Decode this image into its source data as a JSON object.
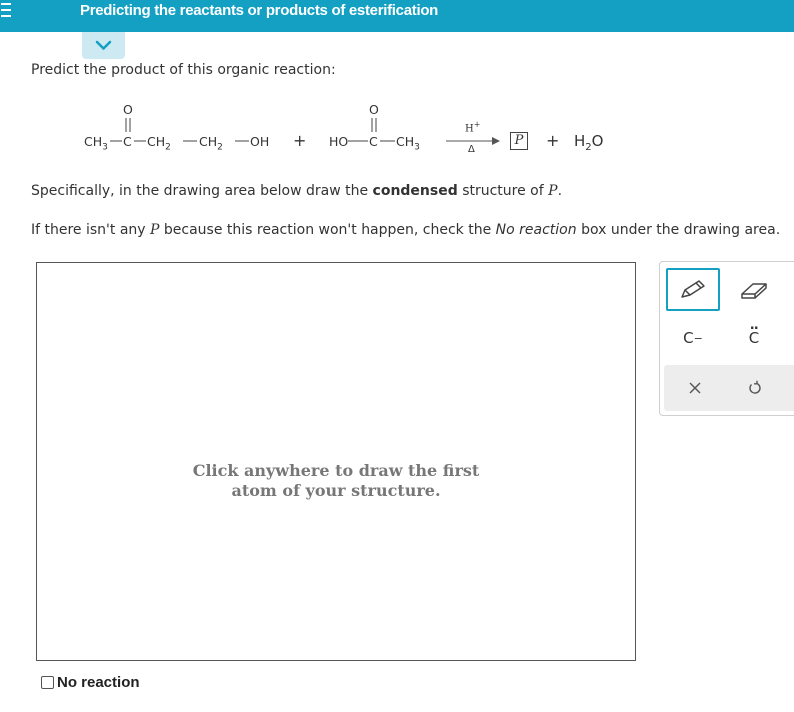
{
  "header": {
    "title": "Predicting the reactants or products of esterification",
    "brand_color": "#13a0c2"
  },
  "question": {
    "prompt": "Predict the product of this organic reaction:",
    "reaction": {
      "reactant1": {
        "ch3": "CH",
        "sub3": "3",
        "c": "C",
        "o": "O",
        "ch2a": "CH",
        "sub2a": "2",
        "ch2b": "CH",
        "sub2b": "2",
        "oh": "OH"
      },
      "plus1": "+",
      "reactant2": {
        "ho": "HO",
        "c": "C",
        "o": "O",
        "ch3": "CH",
        "sub3": "3"
      },
      "catalyst": "H",
      "catalyst_charge": "+",
      "condition": "Δ",
      "product_symbol": "P",
      "plus2": "+",
      "water_h": "H",
      "water_sub": "2",
      "water_o": "O"
    },
    "instruction": {
      "part1": "Specifically, in the drawing area below draw the ",
      "bold": "condensed",
      "part2": " structure of ",
      "symbol": "P",
      "period": "."
    },
    "no_reaction_hint": {
      "part1": "If there isn't any ",
      "symbol": "P",
      "part2": " because this reaction won't happen, check the ",
      "italic": "No reaction",
      "part3": " box under the drawing area."
    }
  },
  "drawing_area": {
    "hint_line1": "Click anywhere to draw the first",
    "hint_line2": "atom of your structure."
  },
  "toolbox": {
    "anion_label": "C",
    "anion_charge": "−",
    "lone_pair_label": "C",
    "lone_pair_dots": "..",
    "icons": [
      "pencil-icon",
      "eraser-icon",
      "close-icon",
      "undo-icon"
    ]
  },
  "no_reaction": {
    "label": "No reaction",
    "checked": false
  }
}
